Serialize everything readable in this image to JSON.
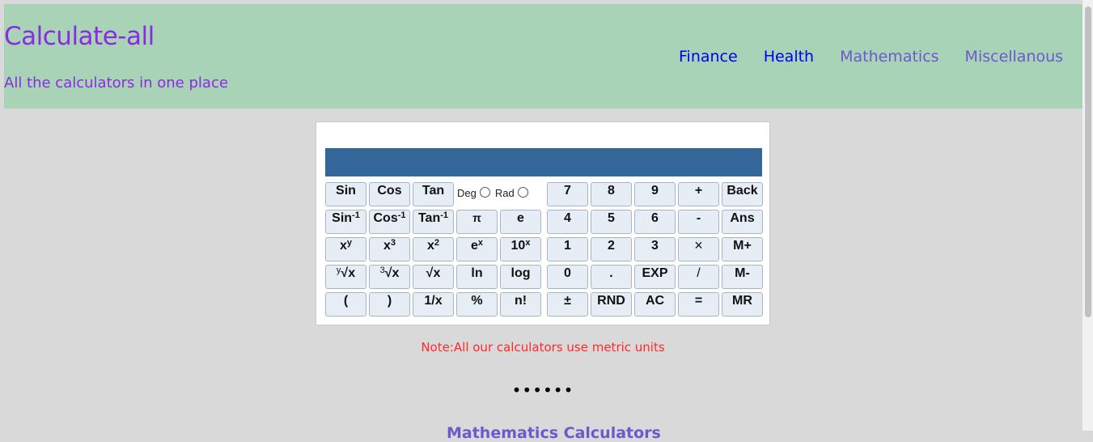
{
  "header": {
    "title": "Calculate-all",
    "subtitle": "All the calculators in one place",
    "nav": [
      {
        "label": "Finance"
      },
      {
        "label": "Health"
      },
      {
        "label": "Mathematics"
      },
      {
        "label": "Miscellanous"
      }
    ]
  },
  "calculator": {
    "display_value": "",
    "angle": {
      "deg": "Deg",
      "rad": "Rad"
    },
    "rows": [
      [
        "Sin",
        "Cos",
        "Tan",
        "",
        "",
        "7",
        "8",
        "9",
        "+",
        "Back"
      ],
      [
        "Sin-1",
        "Cos-1",
        "Tan-1",
        "π",
        "e",
        "4",
        "5",
        "6",
        "-",
        "Ans"
      ],
      [
        "xy",
        "x3",
        "x2",
        "ex",
        "10x",
        "1",
        "2",
        "3",
        "×",
        "M+"
      ],
      [
        "y√x",
        "3√x",
        "√x",
        "ln",
        "log",
        "0",
        ".",
        "EXP",
        "/",
        "M-"
      ],
      [
        "(",
        ")",
        "1/x",
        "%",
        "n!",
        "±",
        "RND",
        "AC",
        "=",
        "MR"
      ]
    ],
    "labels": {
      "sin": "Sin",
      "cos": "Cos",
      "tan": "Tan",
      "sin_inv_base": "Sin",
      "cos_inv_base": "Cos",
      "tan_inv_base": "Tan",
      "inv_sup": "-1",
      "pi": "π",
      "e": "e",
      "pow_base": "x",
      "pow_sup": "y",
      "cube_base": "x",
      "cube_sup": "3",
      "sq_base": "x",
      "sq_sup": "2",
      "exp_base": "e",
      "exp_sup": "x",
      "ten_base": "10",
      "ten_sup": "x",
      "yroot_pre": "y",
      "yroot_body": "√x",
      "croot_pre": "3",
      "croot_body": "√x",
      "sqrt": "√x",
      "ln": "ln",
      "log": "log",
      "lparen": "(",
      "rparen": ")",
      "recip": "1/x",
      "percent": "%",
      "fact": "n!",
      "n7": "7",
      "n8": "8",
      "n9": "9",
      "plus": "+",
      "back": "Back",
      "n4": "4",
      "n5": "5",
      "n6": "6",
      "minus": "-",
      "ans": "Ans",
      "n1": "1",
      "n2": "2",
      "n3": "3",
      "times": "×",
      "mplus": "M+",
      "n0": "0",
      "dot": ".",
      "exp": "EXP",
      "div": "/",
      "mminus": "M-",
      "plusminus": "±",
      "rnd": "RND",
      "ac": "AC",
      "equals": "=",
      "mr": "MR"
    }
  },
  "note": "Note:All our calculators use metric units",
  "dots": "••••••",
  "next_heading": "Mathematics Calculators"
}
